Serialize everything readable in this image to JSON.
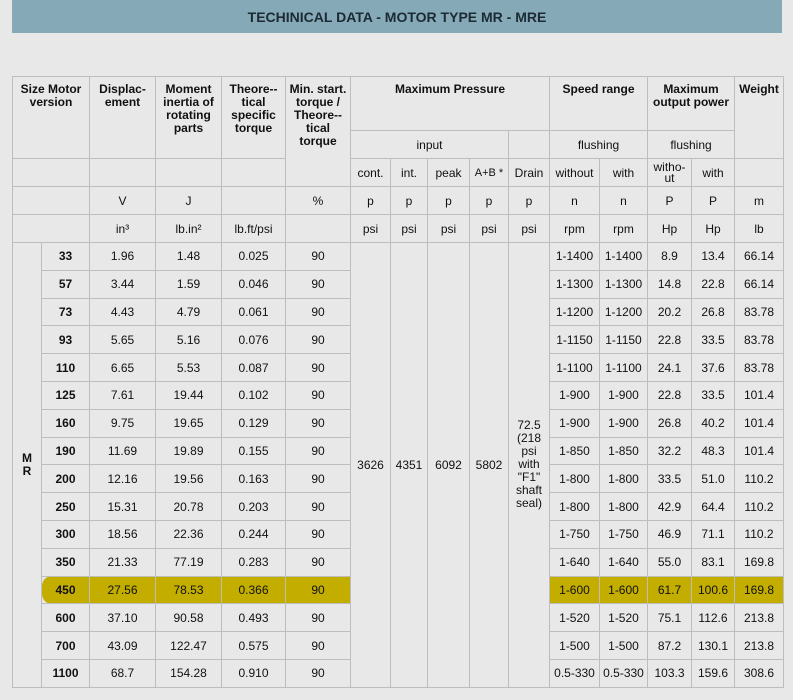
{
  "banner": {
    "title": "TECHINICAL DATA - MOTOR TYPE MR - MRE"
  },
  "headers": {
    "size": "Size Motor version",
    "displacement": "Displac-ement",
    "inertia": "Moment inertia of rotating parts",
    "theoretical_torque": "Theore-- tical specific torque",
    "min_torque": "Min. start. torque / Theore-- tical torque",
    "max_pressure": "Maximum Pressure",
    "speed_range": "Speed range",
    "max_power": "Maximum output power",
    "weight": "Weight",
    "input": "input",
    "flushing_speed": "flushing",
    "flushing_power": "flushing",
    "cont": "cont.",
    "int": "int.",
    "peak": "peak",
    "ab": "A+B *",
    "drain": "Drain",
    "without": "without",
    "with": "with",
    "witho_ut": "witho- ut",
    "with_p": "with"
  },
  "symbols": [
    "V",
    "J",
    "",
    "%",
    "p",
    "p",
    "p",
    "p",
    "p",
    "n",
    "n",
    "P",
    "P",
    "m"
  ],
  "units": [
    "in³",
    "lb.in²",
    "lb.ft/psi",
    "",
    "psi",
    "psi",
    "psi",
    "psi",
    "psi",
    "rpm",
    "rpm",
    "Hp",
    "Hp",
    "lb"
  ],
  "motor_version": "M R",
  "shared_pressure": {
    "cont": "3626",
    "int": "4351",
    "peak": "6092",
    "ab": "5802",
    "drain": "72.5 (218 psi with \"F1\" shaft seal)"
  },
  "rows": [
    {
      "size": "33",
      "disp": "1.96",
      "inertia": "1.48",
      "torque": "0.025",
      "min": "90",
      "without": "1-1400",
      "with": "1-1400",
      "p1": "8.9",
      "p2": "13.4",
      "weight": "66.14"
    },
    {
      "size": "57",
      "disp": "3.44",
      "inertia": "1.59",
      "torque": "0.046",
      "min": "90",
      "without": "1-1300",
      "with": "1-1300",
      "p1": "14.8",
      "p2": "22.8",
      "weight": "66.14"
    },
    {
      "size": "73",
      "disp": "4.43",
      "inertia": "4.79",
      "torque": "0.061",
      "min": "90",
      "without": "1-1200",
      "with": "1-1200",
      "p1": "20.2",
      "p2": "26.8",
      "weight": "83.78"
    },
    {
      "size": "93",
      "disp": "5.65",
      "inertia": "5.16",
      "torque": "0.076",
      "min": "90",
      "without": "1-1150",
      "with": "1-1150",
      "p1": "22.8",
      "p2": "33.5",
      "weight": "83.78"
    },
    {
      "size": "110",
      "disp": "6.65",
      "inertia": "5.53",
      "torque": "0.087",
      "min": "90",
      "without": "1-1100",
      "with": "1-1100",
      "p1": "24.1",
      "p2": "37.6",
      "weight": "83.78"
    },
    {
      "size": "125",
      "disp": "7.61",
      "inertia": "19.44",
      "torque": "0.102",
      "min": "90",
      "without": "1-900",
      "with": "1-900",
      "p1": "22.8",
      "p2": "33.5",
      "weight": "101.4"
    },
    {
      "size": "160",
      "disp": "9.75",
      "inertia": "19.65",
      "torque": "0.129",
      "min": "90",
      "without": "1-900",
      "with": "1-900",
      "p1": "26.8",
      "p2": "40.2",
      "weight": "101.4"
    },
    {
      "size": "190",
      "disp": "11.69",
      "inertia": "19.89",
      "torque": "0.155",
      "min": "90",
      "without": "1-850",
      "with": "1-850",
      "p1": "32.2",
      "p2": "48.3",
      "weight": "101.4"
    },
    {
      "size": "200",
      "disp": "12.16",
      "inertia": "19.56",
      "torque": "0.163",
      "min": "90",
      "without": "1-800",
      "with": "1-800",
      "p1": "33.5",
      "p2": "51.0",
      "weight": "110.2"
    },
    {
      "size": "250",
      "disp": "15.31",
      "inertia": "20.78",
      "torque": "0.203",
      "min": "90",
      "without": "1-800",
      "with": "1-800",
      "p1": "42.9",
      "p2": "64.4",
      "weight": "110.2"
    },
    {
      "size": "300",
      "disp": "18.56",
      "inertia": "22.36",
      "torque": "0.244",
      "min": "90",
      "without": "1-750",
      "with": "1-750",
      "p1": "46.9",
      "p2": "71.1",
      "weight": "110.2"
    },
    {
      "size": "350",
      "disp": "21.33",
      "inertia": "77.19",
      "torque": "0.283",
      "min": "90",
      "without": "1-640",
      "with": "1-640",
      "p1": "55.0",
      "p2": "83.1",
      "weight": "169.8"
    },
    {
      "size": "450",
      "disp": "27.56",
      "inertia": "78.53",
      "torque": "0.366",
      "min": "90",
      "without": "1-600",
      "with": "1-600",
      "p1": "61.7",
      "p2": "100.6",
      "weight": "169.8",
      "highlight": true
    },
    {
      "size": "600",
      "disp": "37.10",
      "inertia": "90.58",
      "torque": "0.493",
      "min": "90",
      "without": "1-520",
      "with": "1-520",
      "p1": "75.1",
      "p2": "112.6",
      "weight": "213.8"
    },
    {
      "size": "700",
      "disp": "43.09",
      "inertia": "122.47",
      "torque": "0.575",
      "min": "90",
      "without": "1-500",
      "with": "1-500",
      "p1": "87.2",
      "p2": "130.1",
      "weight": "213.8"
    },
    {
      "size": "1100",
      "disp": "68.7",
      "inertia": "154.28",
      "torque": "0.910",
      "min": "90",
      "without": "0.5-330",
      "with": "0.5-330",
      "p1": "103.3",
      "p2": "159.6",
      "weight": "308.6"
    }
  ],
  "highlight_color": "#c3ae00"
}
